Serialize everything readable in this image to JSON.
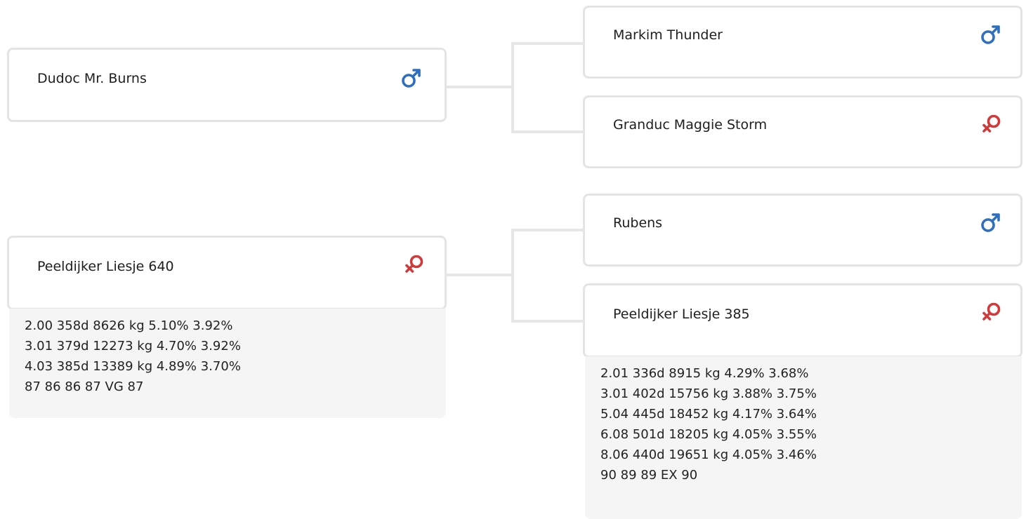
{
  "colors": {
    "male": "#2f6fbf",
    "female": "#d03a3a",
    "border": "#e4e4e4",
    "stats_bg": "#f5f5f5"
  },
  "parents": [
    {
      "name": "Dudoc Mr. Burns",
      "sex": "male",
      "sex_icon": "male-icon"
    },
    {
      "name": "Peeldijker Liesje 640",
      "sex": "female",
      "sex_icon": "female-icon",
      "stats": [
        "2.00 358d 8626 kg 5.10% 3.92%",
        "3.01 379d 12273 kg 4.70% 3.92%",
        "4.03 385d 13389 kg 4.89% 3.70%",
        "87 86 86 87 VG 87"
      ]
    }
  ],
  "grandparents": [
    {
      "name": "Markim Thunder",
      "sex": "male",
      "sex_icon": "male-icon"
    },
    {
      "name": "Granduc Maggie Storm",
      "sex": "female",
      "sex_icon": "female-icon"
    },
    {
      "name": "Rubens",
      "sex": "male",
      "sex_icon": "male-icon"
    },
    {
      "name": "Peeldijker Liesje 385",
      "sex": "female",
      "sex_icon": "female-icon",
      "stats": [
        "2.01 336d 8915 kg 4.29% 3.68%",
        "3.01 402d 15756 kg 3.88% 3.75%",
        "5.04 445d 18452 kg 4.17% 3.64%",
        "6.08 501d 18205 kg 4.05% 3.55%",
        "8.06 440d 19651 kg 4.05% 3.46%",
        "90 89 89 EX 90"
      ]
    }
  ]
}
